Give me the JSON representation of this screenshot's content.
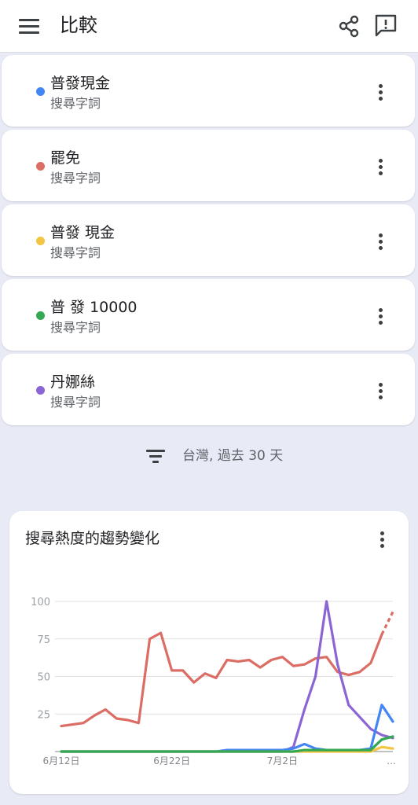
{
  "header": {
    "title": "比較"
  },
  "terms": [
    {
      "name": "普發現金",
      "type": "搜尋字詞",
      "color": "#4285f4"
    },
    {
      "name": "罷免",
      "type": "搜尋字詞",
      "color": "#db6d64"
    },
    {
      "name": "普發 現金",
      "type": "搜尋字詞",
      "color": "#f4c542"
    },
    {
      "name": "普 發 10000",
      "type": "搜尋字詞",
      "color": "#34a853"
    },
    {
      "name": "丹娜絲",
      "type": "搜尋字詞",
      "color": "#8b65d4"
    }
  ],
  "filter": {
    "label": "台灣, 過去 30 天"
  },
  "chart": {
    "title": "搜尋熱度的趨勢變化"
  },
  "chart_data": {
    "type": "line",
    "x_ticks": [
      "6月12日",
      "6月22日",
      "7月2日",
      "..."
    ],
    "ylim": [
      0,
      100
    ],
    "y_ticks": [
      100,
      75,
      50,
      25
    ],
    "grid": true,
    "legend": "none",
    "x": [
      "6月12日",
      "6月13日",
      "6月14日",
      "6月15日",
      "6月16日",
      "6月17日",
      "6月18日",
      "6月19日",
      "6月20日",
      "6月21日",
      "6月22日",
      "6月23日",
      "6月24日",
      "6月25日",
      "6月26日",
      "6月27日",
      "6月28日",
      "6月29日",
      "6月30日",
      "7月1日",
      "7月2日",
      "7月3日",
      "7月4日",
      "7月5日",
      "7月6日",
      "7月7日",
      "7月8日",
      "7月9日",
      "7月10日",
      "7月11日",
      "7月12日"
    ],
    "series": [
      {
        "name": "罷免",
        "color": "#db6d64",
        "values": [
          17,
          18,
          19,
          24,
          28,
          22,
          21,
          19,
          75,
          79,
          54,
          54,
          46,
          52,
          49,
          61,
          60,
          61,
          56,
          61,
          63,
          57,
          58,
          62,
          63,
          53,
          51,
          53,
          59,
          78,
          93
        ],
        "partial_from_index": 29
      },
      {
        "name": "丹娜絲",
        "color": "#8b65d4",
        "values": [
          0,
          0,
          0,
          0,
          0,
          0,
          0,
          0,
          0,
          0,
          0,
          0,
          0,
          0,
          0,
          0,
          0,
          0,
          0,
          0,
          0,
          3,
          28,
          50,
          100,
          58,
          31,
          23,
          15,
          11,
          9
        ]
      },
      {
        "name": "普發現金",
        "color": "#4285f4",
        "values": [
          0,
          0,
          0,
          0,
          0,
          0,
          0,
          0,
          0,
          0,
          0,
          0,
          0,
          0,
          0,
          1,
          1,
          1,
          1,
          1,
          1,
          2,
          5,
          2,
          1,
          1,
          1,
          1,
          2,
          31,
          20
        ]
      },
      {
        "name": "普發 現金",
        "color": "#f4c542",
        "values": [
          0,
          0,
          0,
          0,
          0,
          0,
          0,
          0,
          0,
          0,
          0,
          0,
          0,
          0,
          0,
          0,
          0,
          0,
          0,
          0,
          0,
          0,
          0,
          0,
          0,
          0,
          0,
          0,
          0,
          3,
          2
        ]
      },
      {
        "name": "普 發 10000",
        "color": "#34a853",
        "values": [
          0,
          0,
          0,
          0,
          0,
          0,
          0,
          0,
          0,
          0,
          0,
          0,
          0,
          0,
          0,
          0,
          0,
          0,
          0,
          0,
          0,
          0,
          1,
          1,
          1,
          1,
          1,
          1,
          1,
          8,
          10
        ]
      }
    ]
  }
}
